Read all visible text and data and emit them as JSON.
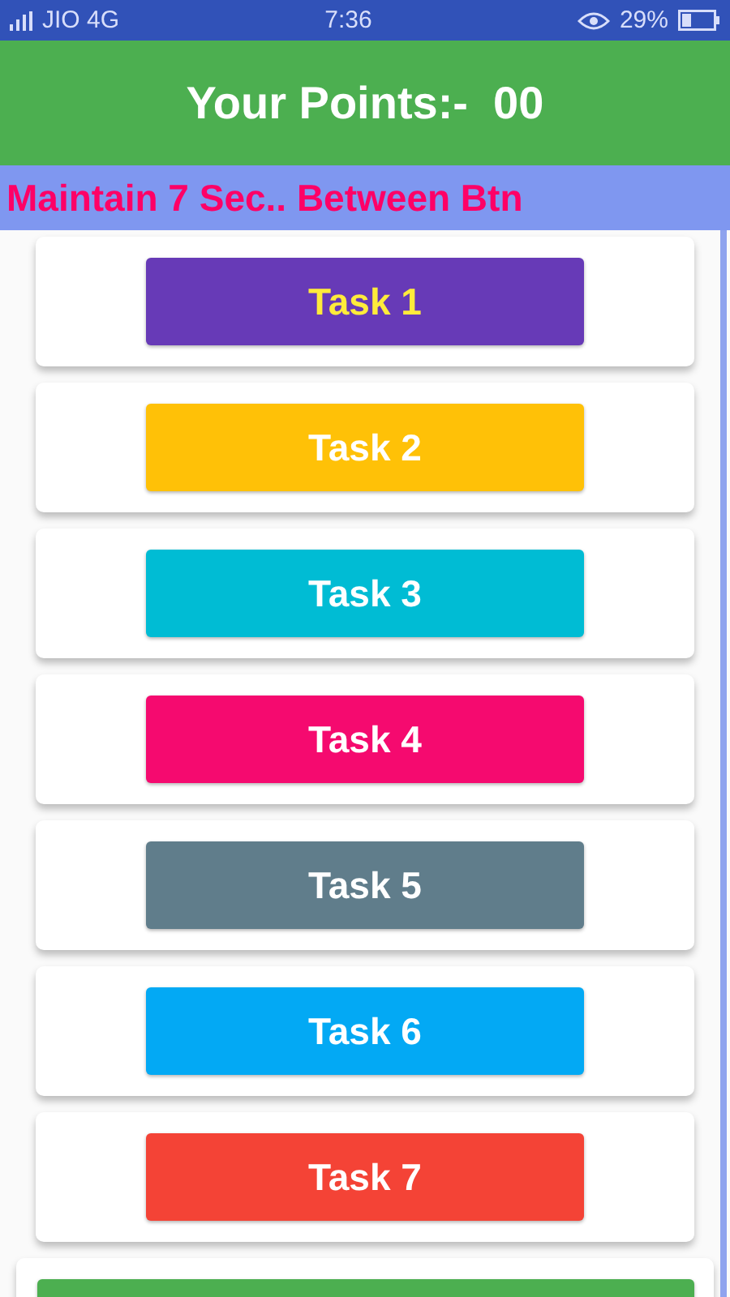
{
  "status_bar": {
    "carrier": "JIO 4G",
    "time": "7:36",
    "battery": "29%"
  },
  "header": {
    "title": "Your Points:-  00"
  },
  "banner": {
    "text": "Maintain 7 Sec.. Between Btn"
  },
  "tasks": [
    {
      "label": "Task 1",
      "color": "#673ab7",
      "highlighted": true
    },
    {
      "label": "Task 2",
      "color": "#ffc107",
      "highlighted": false
    },
    {
      "label": "Task 3",
      "color": "#00bcd4",
      "highlighted": false
    },
    {
      "label": "Task 4",
      "color": "#f50a6f",
      "highlighted": false
    },
    {
      "label": "Task 5",
      "color": "#607d8b",
      "highlighted": false
    },
    {
      "label": "Task 6",
      "color": "#03a9f4",
      "highlighted": false
    },
    {
      "label": "Task 7",
      "color": "#f44336",
      "highlighted": false
    }
  ],
  "partial_button": {
    "color": "#4caf50"
  }
}
